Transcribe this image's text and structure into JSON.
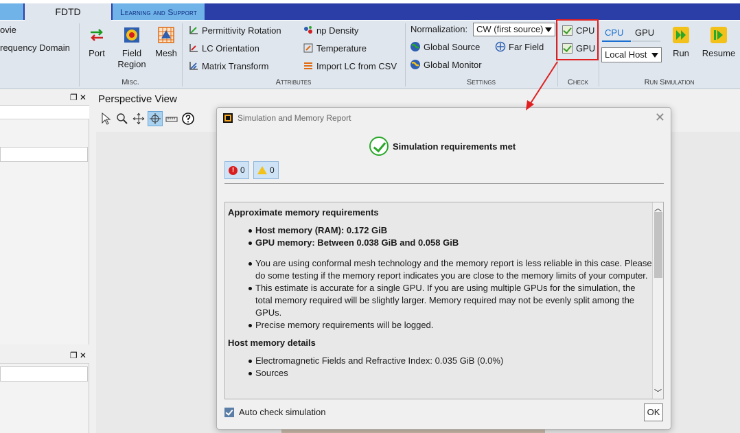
{
  "tabs": {
    "fdtd": "FDTD",
    "learning": "Learning and Support"
  },
  "ribbon": {
    "movie_partial": "ovie",
    "frequency_partial": "requency Domain",
    "misc": {
      "label": "Misc.",
      "port": "Port",
      "field_region": "Field Region",
      "mesh": "Mesh"
    },
    "attributes": {
      "label": "Attributes",
      "permittivity_rotation": "Permittivity Rotation",
      "lc_orientation": "LC Orientation",
      "matrix_transform": "Matrix Transform",
      "np_density": "np Density",
      "temperature": "Temperature",
      "import_lc": "Import LC from CSV"
    },
    "settings": {
      "label": "Settings",
      "normalization_label": "Normalization:",
      "normalization_value": "CW (first source)",
      "global_source": "Global Source",
      "far_field": "Far Field",
      "global_monitor": "Global Monitor"
    },
    "check": {
      "label": "Check",
      "cpu": "CPU",
      "gpu": "GPU"
    },
    "run": {
      "label": "Run Simulation",
      "cpu_tab": "CPU",
      "gpu_tab": "GPU",
      "host_value": "Local Host",
      "run": "Run",
      "resume": "Resume"
    }
  },
  "perspective_view": {
    "title": "Perspective View"
  },
  "dialog": {
    "title": "Simulation and Memory Report",
    "status": "Simulation requirements met",
    "errors": "0",
    "warnings": "0",
    "report": {
      "approx_heading": "Approximate memory requirements",
      "host_mem": "Host memory (RAM): 0.172 GiB",
      "gpu_mem": "GPU memory: Between 0.038 GiB and 0.058 GiB",
      "note1": "You are using conformal mesh technology and the memory report is less reliable in this case. Please do some testing if the memory report indicates you are close to the memory limits of your computer.",
      "note2": "This estimate is accurate for a single GPU. If you are using multiple GPUs for the simulation, the total memory required will be slightly larger. Memory required may not be evenly split among the GPUs.",
      "note3": "Precise memory requirements will be logged.",
      "host_details_heading": "Host memory details",
      "detail1": "Electromagnetic Fields and Refractive Index: 0.035 GiB (0.0%)",
      "detail2": "Sources"
    },
    "auto_check": "Auto check simulation",
    "ok": "OK"
  },
  "colors": {
    "highlight": "#e02020",
    "accent": "#2b3ea8"
  }
}
